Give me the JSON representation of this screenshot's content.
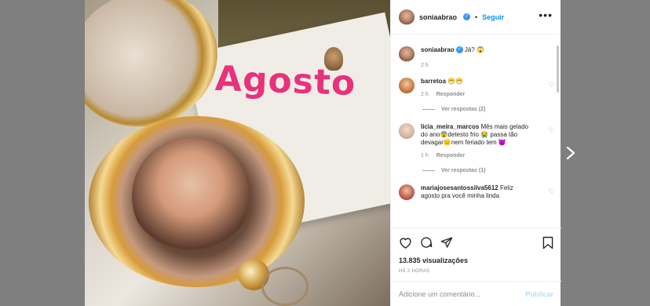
{
  "post": {
    "image_text": "Agosto",
    "author": "soniaabrao",
    "follow_label": "Seguir",
    "separator": "•",
    "more_label": "•••"
  },
  "caption": {
    "author": "soniaabrao",
    "text": "Já? 😱",
    "time": "2 h"
  },
  "comments": [
    {
      "author": "barretoa",
      "text": "😁😁",
      "time": "2 h",
      "reply_label": "Responder",
      "view_replies": "Ver respostas (2)"
    },
    {
      "author": "licia_meira_marcos",
      "text": "Mês mais gelado do ano😨detesto frio 😭 passa tão devagar😑nem feriado tem 😈",
      "time": "1 h",
      "reply_label": "Responder",
      "view_replies": "Ver respostas (1)"
    },
    {
      "author": "mariajosesantossilva5612",
      "text": "Feliz agosto pra você minha linda"
    }
  ],
  "stats": {
    "views": "13.835 visualizações",
    "posted": "HÁ 2 HORAS"
  },
  "comment_box": {
    "placeholder": "Adicione um comentário...",
    "publish_label": "Publicar"
  },
  "icons": {
    "like": "heart-icon",
    "comment": "comment-icon",
    "share": "send-icon",
    "save": "bookmark-icon",
    "next": "chevron-right-icon"
  },
  "colors": {
    "accent": "#0095f6",
    "headline": "#e8327a"
  }
}
